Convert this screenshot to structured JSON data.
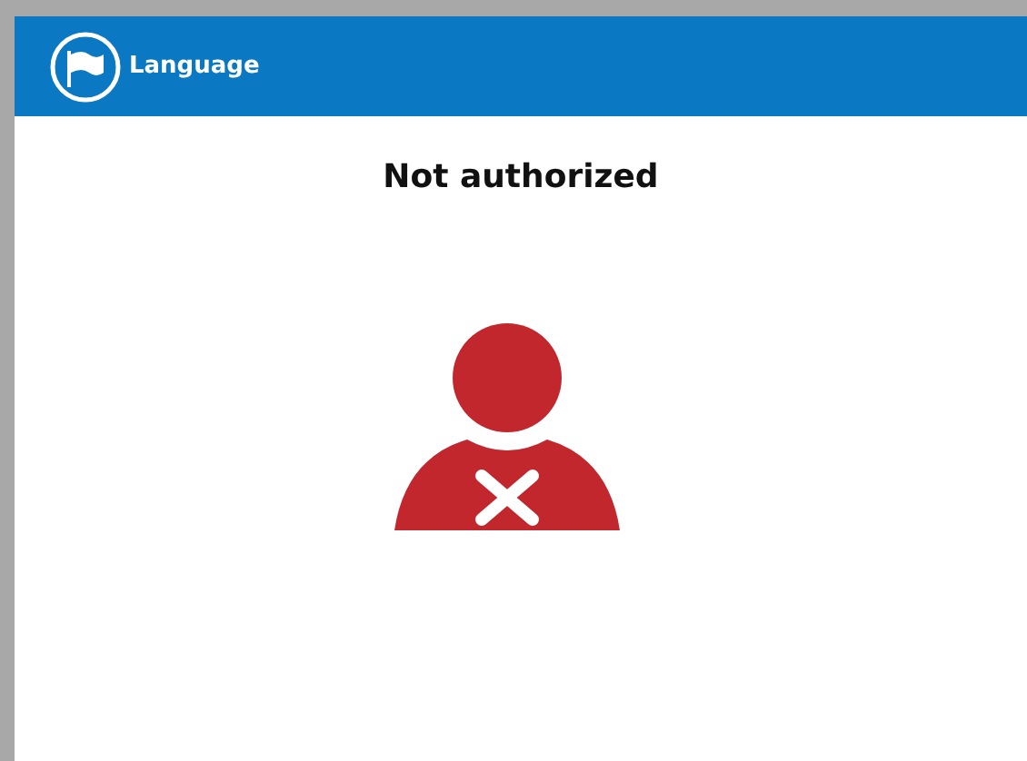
{
  "header": {
    "title": "Language"
  },
  "message": "Not authorized"
}
